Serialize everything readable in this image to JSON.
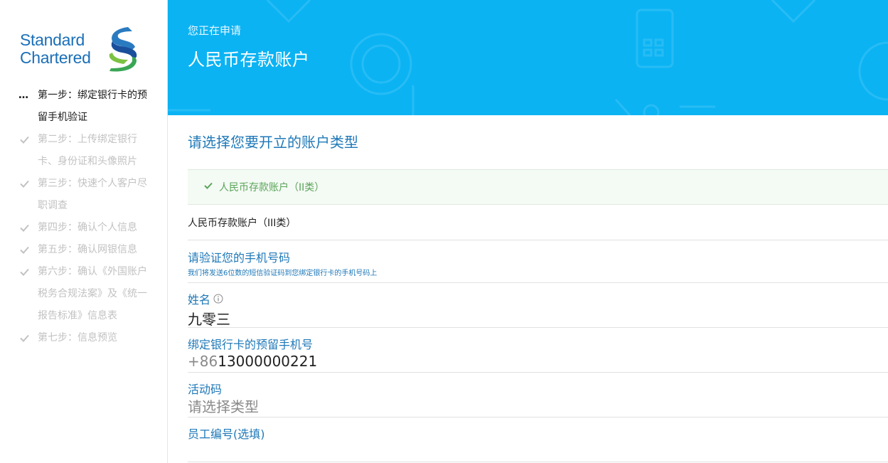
{
  "brand": {
    "line1": "Standard",
    "line2": "Chartered",
    "color": "#1a6fb8",
    "mark_icon": "standard-chartered-swoosh-logo"
  },
  "sidebar": {
    "steps": [
      {
        "label": "第一步：绑定银行卡的预留手机验证",
        "state": "active",
        "marker": "…"
      },
      {
        "label": "第二步：上传绑定银行卡、身份证和头像照片",
        "state": "pending",
        "marker": "check-icon"
      },
      {
        "label": "第三步：快速个人客户尽职调查",
        "state": "pending",
        "marker": "check-icon"
      },
      {
        "label": "第四步：确认个人信息",
        "state": "pending",
        "marker": "check-icon"
      },
      {
        "label": "第五步：确认网银信息",
        "state": "pending",
        "marker": "check-icon"
      },
      {
        "label": "第六步：确认《外国账户税务合规法案》及《统一报告标准》信息表",
        "state": "pending",
        "marker": "check-icon"
      },
      {
        "label": "第七步：信息预览",
        "state": "pending",
        "marker": "check-icon"
      }
    ]
  },
  "banner": {
    "subtitle": "您正在申请",
    "title": "人民币存款账户",
    "background": "#0bb3f3"
  },
  "account_type": {
    "title": "请选择您要开立的账户类型",
    "options": [
      {
        "label": "人民币存款账户（II类）",
        "selected": true
      },
      {
        "label": "人民币存款账户（III类）",
        "selected": false
      }
    ]
  },
  "verification": {
    "title": "请验证您的手机号码",
    "description": "我们将发送6位数的短信验证码到您绑定银行卡的手机号码上"
  },
  "form": {
    "name_label": "姓名",
    "name_value": "九零三",
    "phone_label": "绑定银行卡的预留手机号",
    "phone_prefix": "+86",
    "phone_value": "13000000221",
    "activity_label": "活动码",
    "activity_placeholder": "请选择类型",
    "employee_label": "员工编号(选填)"
  }
}
